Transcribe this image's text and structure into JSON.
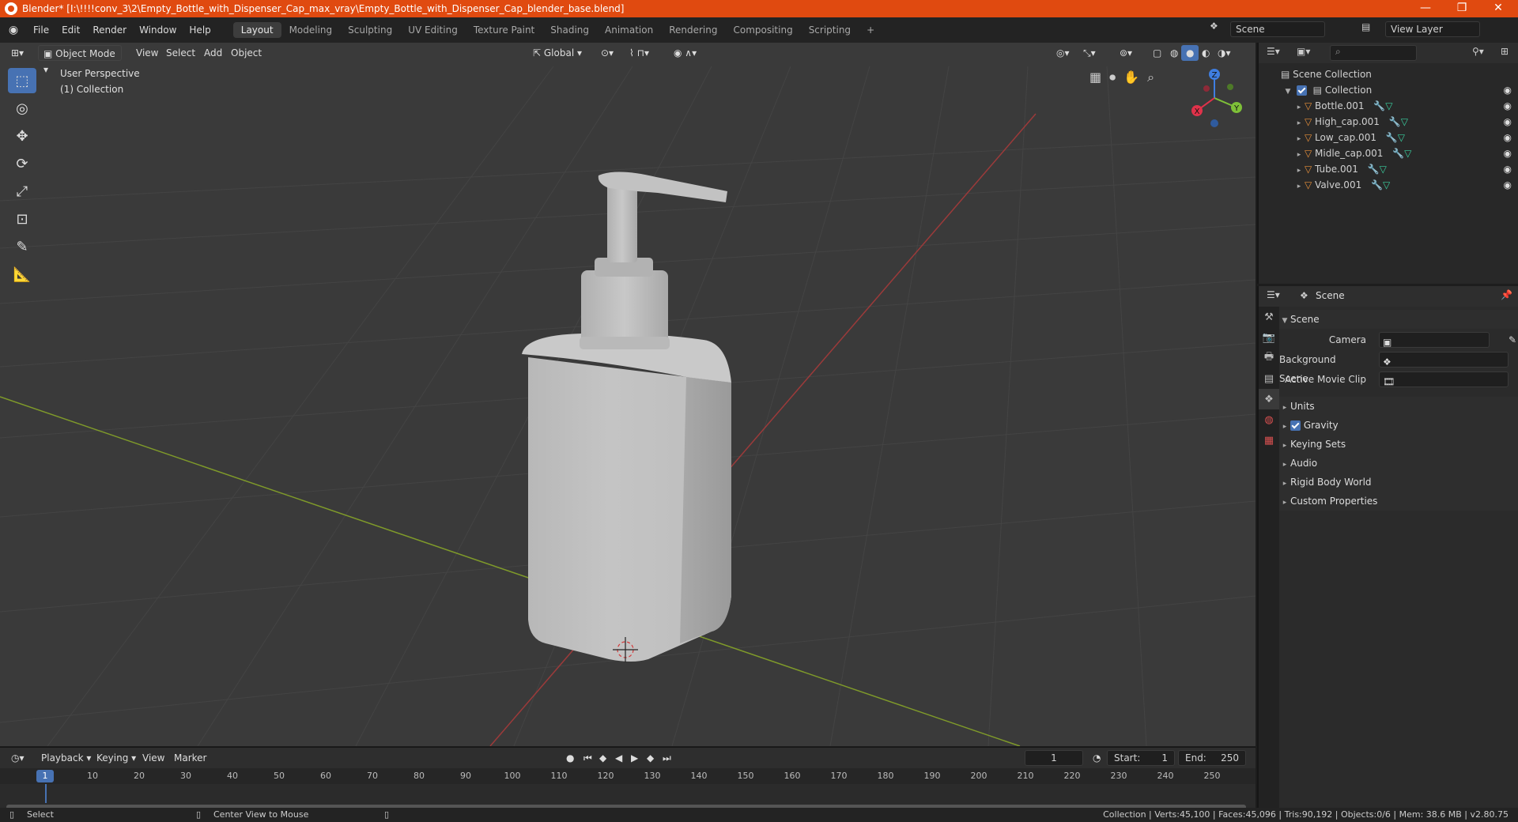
{
  "titlebar": {
    "title": "Blender* [I:\\!!!!conv_3\\2\\Empty_Bottle_with_Dispenser_Cap_max_vray\\Empty_Bottle_with_Dispenser_Cap_blender_base.blend]"
  },
  "menu": [
    "File",
    "Edit",
    "Render",
    "Window",
    "Help"
  ],
  "workspaces": [
    "Layout",
    "Modeling",
    "Sculpting",
    "UV Editing",
    "Texture Paint",
    "Shading",
    "Animation",
    "Rendering",
    "Compositing",
    "Scripting"
  ],
  "active_workspace": "Layout",
  "scene_field": "Scene",
  "view_layer_field": "View Layer",
  "viewport_header": {
    "mode": "Object Mode",
    "menus": [
      "View",
      "Select",
      "Add",
      "Object"
    ],
    "orientation": "Global"
  },
  "viewport": {
    "perspective": "User Perspective",
    "collection": "(1) Collection"
  },
  "gizmo": {
    "x": "X",
    "y": "Y",
    "z": "Z"
  },
  "outliner": {
    "root": "Scene Collection",
    "collection": "Collection",
    "objects": [
      "Bottle.001",
      "High_cap.001",
      "Low_cap.001",
      "Midle_cap.001",
      "Tube.001",
      "Valve.001"
    ]
  },
  "properties": {
    "header": "Scene",
    "panel_title": "Scene",
    "fields": [
      {
        "label": "Camera"
      },
      {
        "label": "Background Scene"
      },
      {
        "label": "Active Movie Clip"
      }
    ],
    "sections": [
      "Units",
      "Gravity",
      "Keying Sets",
      "Audio",
      "Rigid Body World",
      "Custom Properties"
    ],
    "gravity_checked": true
  },
  "timeline": {
    "menus": [
      "Playback",
      "Keying",
      "View",
      "Marker"
    ],
    "current_frame": "1",
    "start_label": "Start:",
    "start": "1",
    "end_label": "End:",
    "end": "250",
    "ruler": [
      "10",
      "20",
      "30",
      "40",
      "50",
      "60",
      "70",
      "80",
      "90",
      "100",
      "110",
      "120",
      "130",
      "140",
      "150",
      "160",
      "170",
      "180",
      "190",
      "200",
      "210",
      "220",
      "230",
      "240",
      "250"
    ]
  },
  "statusbar": {
    "select": "Select",
    "center": "Center View to Mouse",
    "stats": "Collection | Verts:45,100 | Faces:45,096 | Tris:90,192 | Objects:0/6 | Mem: 38.6 MB | v2.80.75"
  }
}
